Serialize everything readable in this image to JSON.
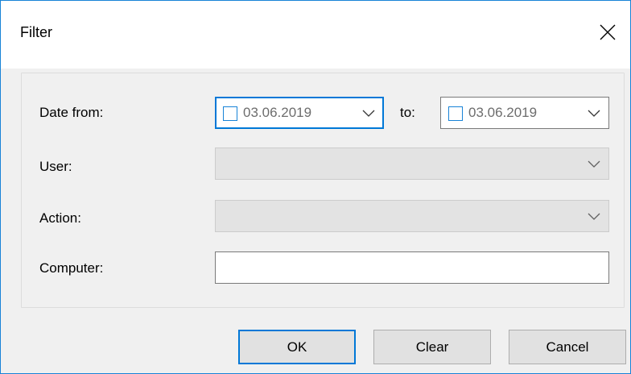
{
  "window": {
    "title": "Filter"
  },
  "form": {
    "date_from_label": "Date from:",
    "date_from_value": "03.06.2019",
    "date_from_checked": false,
    "to_label": "to:",
    "date_to_value": "03.06.2019",
    "date_to_checked": false,
    "user_label": "User:",
    "user_value": "",
    "action_label": "Action:",
    "action_value": "",
    "computer_label": "Computer:",
    "computer_value": ""
  },
  "buttons": {
    "ok": "OK",
    "clear": "Clear",
    "cancel": "Cancel"
  },
  "colors": {
    "accent": "#0078d7",
    "window_border": "#1883d7",
    "dialog_bg": "#f0f0f0",
    "disabled_field_bg": "#e3e3e3",
    "disabled_text": "#6d6d6d"
  }
}
